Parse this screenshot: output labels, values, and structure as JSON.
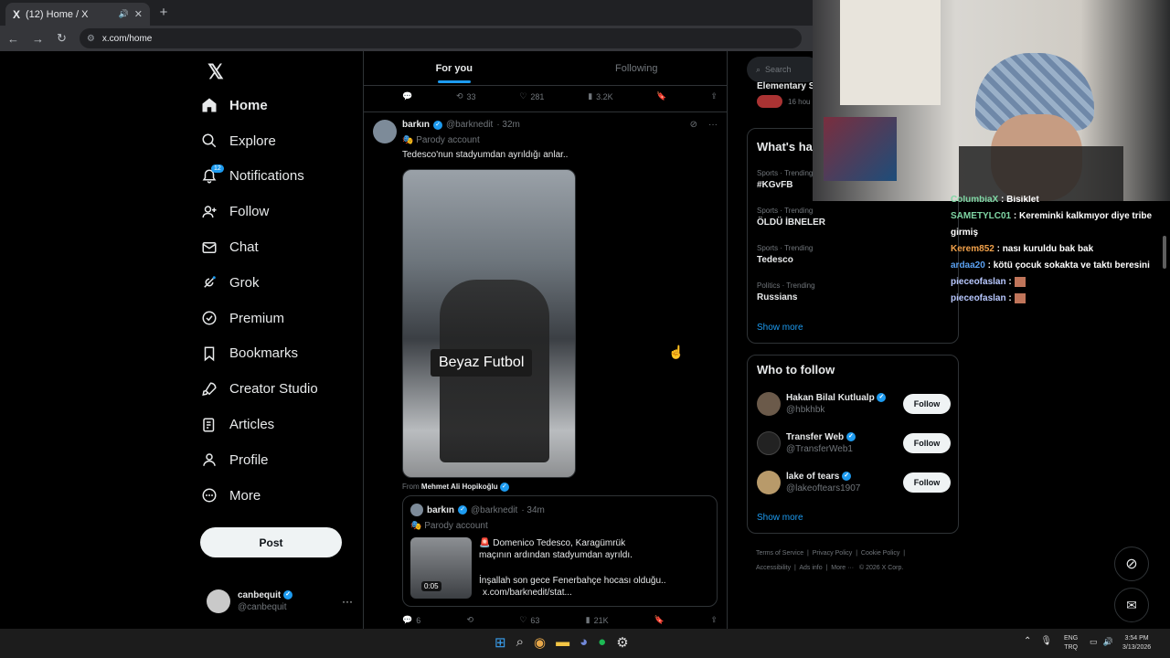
{
  "browser": {
    "tab_title": "(12) Home / X",
    "tab_favicon": "X",
    "url": "x.com/home"
  },
  "sidebar": {
    "logo": "𝕏",
    "items": [
      {
        "label": "Home",
        "icon": "home-icon",
        "active": true
      },
      {
        "label": "Explore",
        "icon": "search-icon"
      },
      {
        "label": "Notifications",
        "icon": "bell-icon",
        "badge": "12"
      },
      {
        "label": "Follow",
        "icon": "person-add-icon"
      },
      {
        "label": "Chat",
        "icon": "envelope-icon"
      },
      {
        "label": "Grok",
        "icon": "grok-icon"
      },
      {
        "label": "Premium",
        "icon": "verified-icon"
      },
      {
        "label": "Bookmarks",
        "icon": "bookmark-icon"
      },
      {
        "label": "Creator Studio",
        "icon": "rocket-icon"
      },
      {
        "label": "Articles",
        "icon": "article-icon"
      },
      {
        "label": "Profile",
        "icon": "person-icon"
      },
      {
        "label": "More",
        "icon": "more-circle-icon"
      }
    ],
    "post_label": "Post",
    "account": {
      "name": "canbequit",
      "handle": "@canbequit"
    }
  },
  "timeline": {
    "tabs": [
      {
        "label": "For you",
        "active": true
      },
      {
        "label": "Following"
      }
    ],
    "top_actions": {
      "retweets": "33",
      "likes": "281",
      "views": "3.2K"
    },
    "post": {
      "author": "barkın",
      "handle": "@barknedit",
      "time": "· 32m",
      "label": "Parody account",
      "text": "Tedesco'nun stadyumdan ayrıldığı anlar..",
      "media_caption": "Beyaz Futbol",
      "from_prefix": "From",
      "from_name": "Mehmet Ali Hopikoğlu",
      "quote": {
        "author": "barkın",
        "handle": "@barknedit",
        "time": "· 34m",
        "label": "Parody account",
        "line1": "🚨 Domenico Tedesco, Karagümrük",
        "line2": "maçının ardından stadyumdan ayrıldı.",
        "line3": "İnşallah son gece Fenerbahçe hocası olduğu..",
        "line4": "x.com/barknedit/stat...",
        "video_duration": "0:05"
      },
      "actions": {
        "replies": "6",
        "likes": "63",
        "views": "21K"
      }
    }
  },
  "right": {
    "search_placeholder": "Search",
    "top_snippet": "Elementary S",
    "top_time": "16 hou",
    "trends_title": "What's ha",
    "trends": [
      {
        "category": "Sports · Trending",
        "name": "#KGvFB"
      },
      {
        "category": "Sports · Trending",
        "name": "ÖLDÜ İBNELER"
      },
      {
        "category": "Sports · Trending",
        "name": "Tedesco"
      },
      {
        "category": "Politics · Trending",
        "name": "Russians"
      }
    ],
    "show_more": "Show more",
    "who_to_follow_title": "Who to follow",
    "who_to_follow": [
      {
        "name": "Hakan Bilal Kutlualp",
        "handle": "@hbkhbk"
      },
      {
        "name": "Transfer Web",
        "handle": "@TransferWeb1"
      },
      {
        "name": "lake of tears",
        "handle": "@lakeoftears1907"
      }
    ],
    "follow_label": "Follow",
    "footer": [
      "Terms of Service",
      "Privacy Policy",
      "Cookie Policy",
      "Accessibility",
      "Ads info",
      "More ···",
      "© 2026 X Corp."
    ]
  },
  "chat": {
    "messages": [
      {
        "user": "ColumbiaX",
        "text": ": Bisiklet",
        "color": "#7fd6a4"
      },
      {
        "user": "SAMETYLC01",
        "text": ": Kereminki kalkmıyor diye tribe girmiş",
        "color": "#7fd6a4"
      },
      {
        "user": "Kerem852",
        "text": ": nası kuruldu bak bak",
        "color": "#f2a14a"
      },
      {
        "user": "ardaa20",
        "text": ": kötü çocuk sokakta ve taktı beresini",
        "color": "#5aa0f0"
      },
      {
        "user": "pieceofaslan",
        "text": ":",
        "color": "#b8c8ff"
      },
      {
        "user": "pieceofaslan",
        "text": ":",
        "color": "#b8c8ff"
      }
    ]
  },
  "taskbar": {
    "lang1": "ENG",
    "lang2": "TRQ",
    "time": "3:54 PM",
    "date": "3/13/2026"
  }
}
